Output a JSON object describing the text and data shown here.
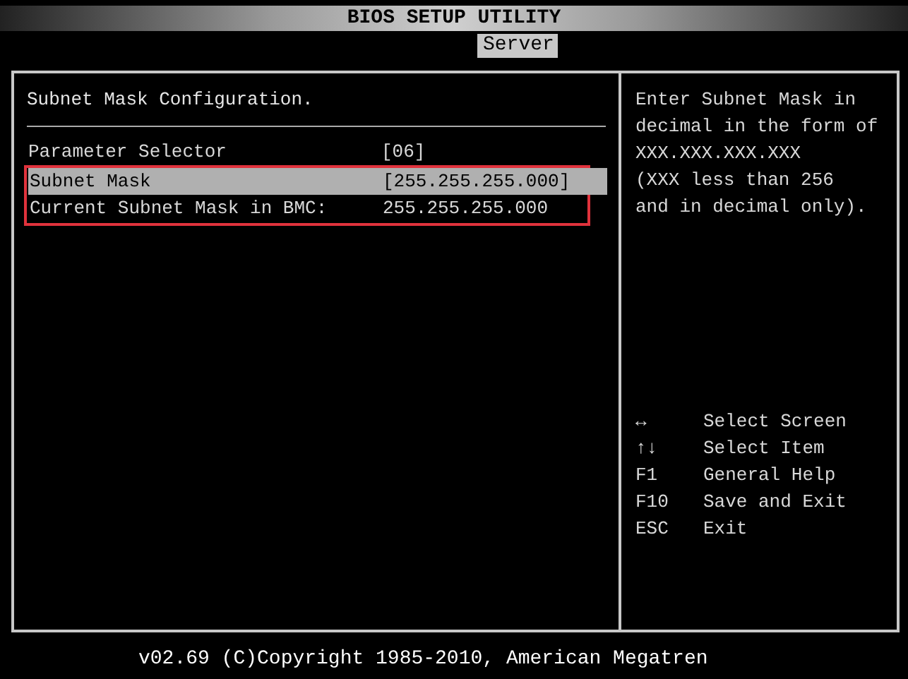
{
  "window": {
    "title": "BIOS SETUP UTILITY"
  },
  "tabs": [
    {
      "label": "Server",
      "selected": true
    }
  ],
  "panel": {
    "heading": "Subnet Mask Configuration.",
    "items": [
      {
        "label": "Parameter Selector",
        "value": "[06]",
        "selected": false,
        "highlighted": false
      },
      {
        "label": "Subnet Mask",
        "value": "[255.255.255.000]",
        "selected": true,
        "highlighted": true
      },
      {
        "label": "Current Subnet Mask in BMC:",
        "value": " 255.255.255.000",
        "selected": false,
        "highlighted": true
      }
    ]
  },
  "help": {
    "lines": [
      "Enter Subnet Mask in",
      "decimal in the form of",
      "XXX.XXX.XXX.XXX",
      "(XXX less than 256",
      "and in decimal only)."
    ],
    "keys": [
      {
        "key": "↔",
        "action": "Select Screen"
      },
      {
        "key": "↑↓",
        "action": "Select Item"
      },
      {
        "key": "F1",
        "action": "General Help"
      },
      {
        "key": "F10",
        "action": "Save and Exit"
      },
      {
        "key": "ESC",
        "action": "Exit"
      }
    ]
  },
  "status_bar": {
    "text": "v02.69 (C)Copyright 1985-2010, American Megatren"
  }
}
